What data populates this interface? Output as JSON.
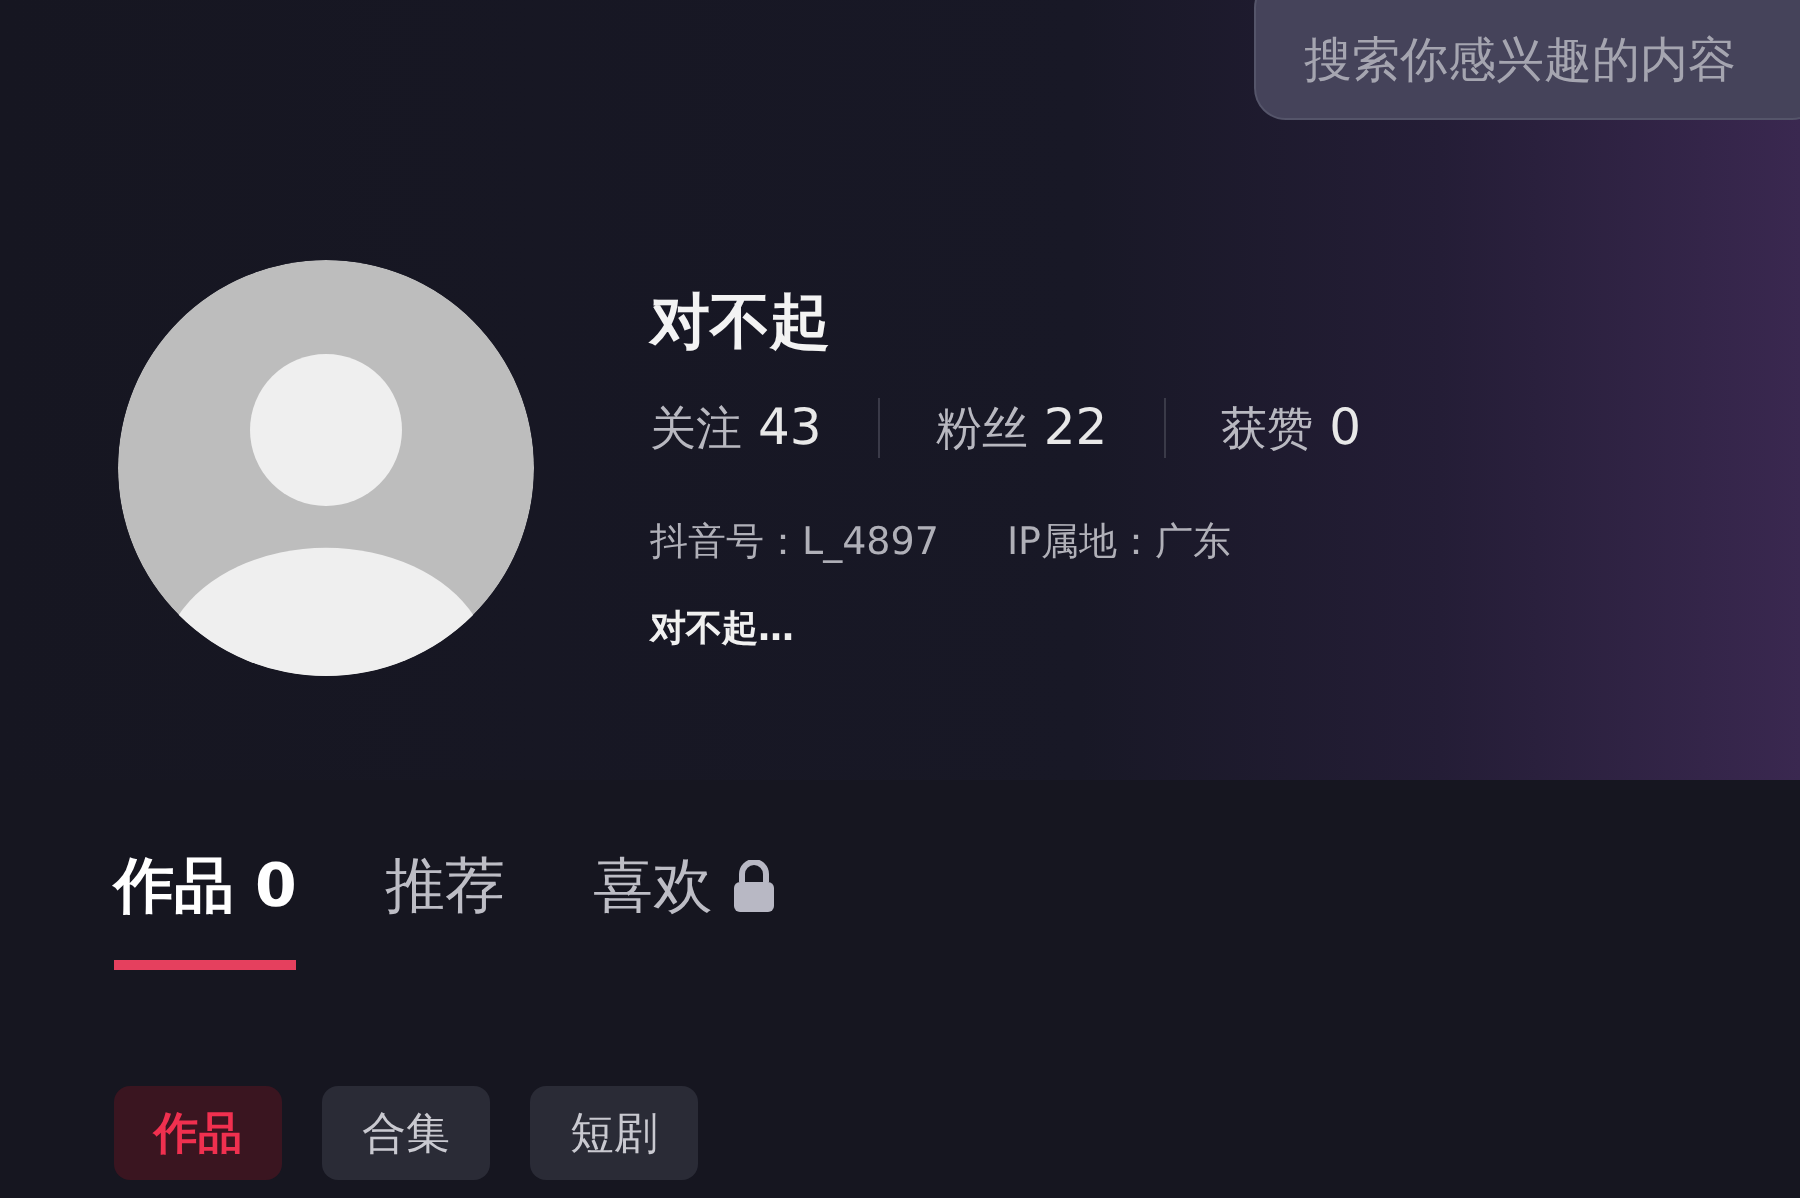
{
  "search": {
    "placeholder": "搜索你感兴趣的内容"
  },
  "profile": {
    "name": "对不起",
    "stats": [
      {
        "label": "关注",
        "value": "43"
      },
      {
        "label": "粉丝",
        "value": "22"
      },
      {
        "label": "获赞",
        "value": "0"
      }
    ],
    "info": [
      "抖音号：L_4897",
      "IP属地：广东"
    ],
    "signature": "对不起…"
  },
  "tabs": [
    {
      "label": "作品 0",
      "selected": true,
      "locked": false
    },
    {
      "label": "推荐",
      "selected": false,
      "locked": false
    },
    {
      "label": "喜欢",
      "selected": false,
      "locked": true
    }
  ],
  "filters": [
    {
      "label": "作品",
      "selected": true
    },
    {
      "label": "合集",
      "selected": false
    },
    {
      "label": "短剧",
      "selected": false
    }
  ]
}
